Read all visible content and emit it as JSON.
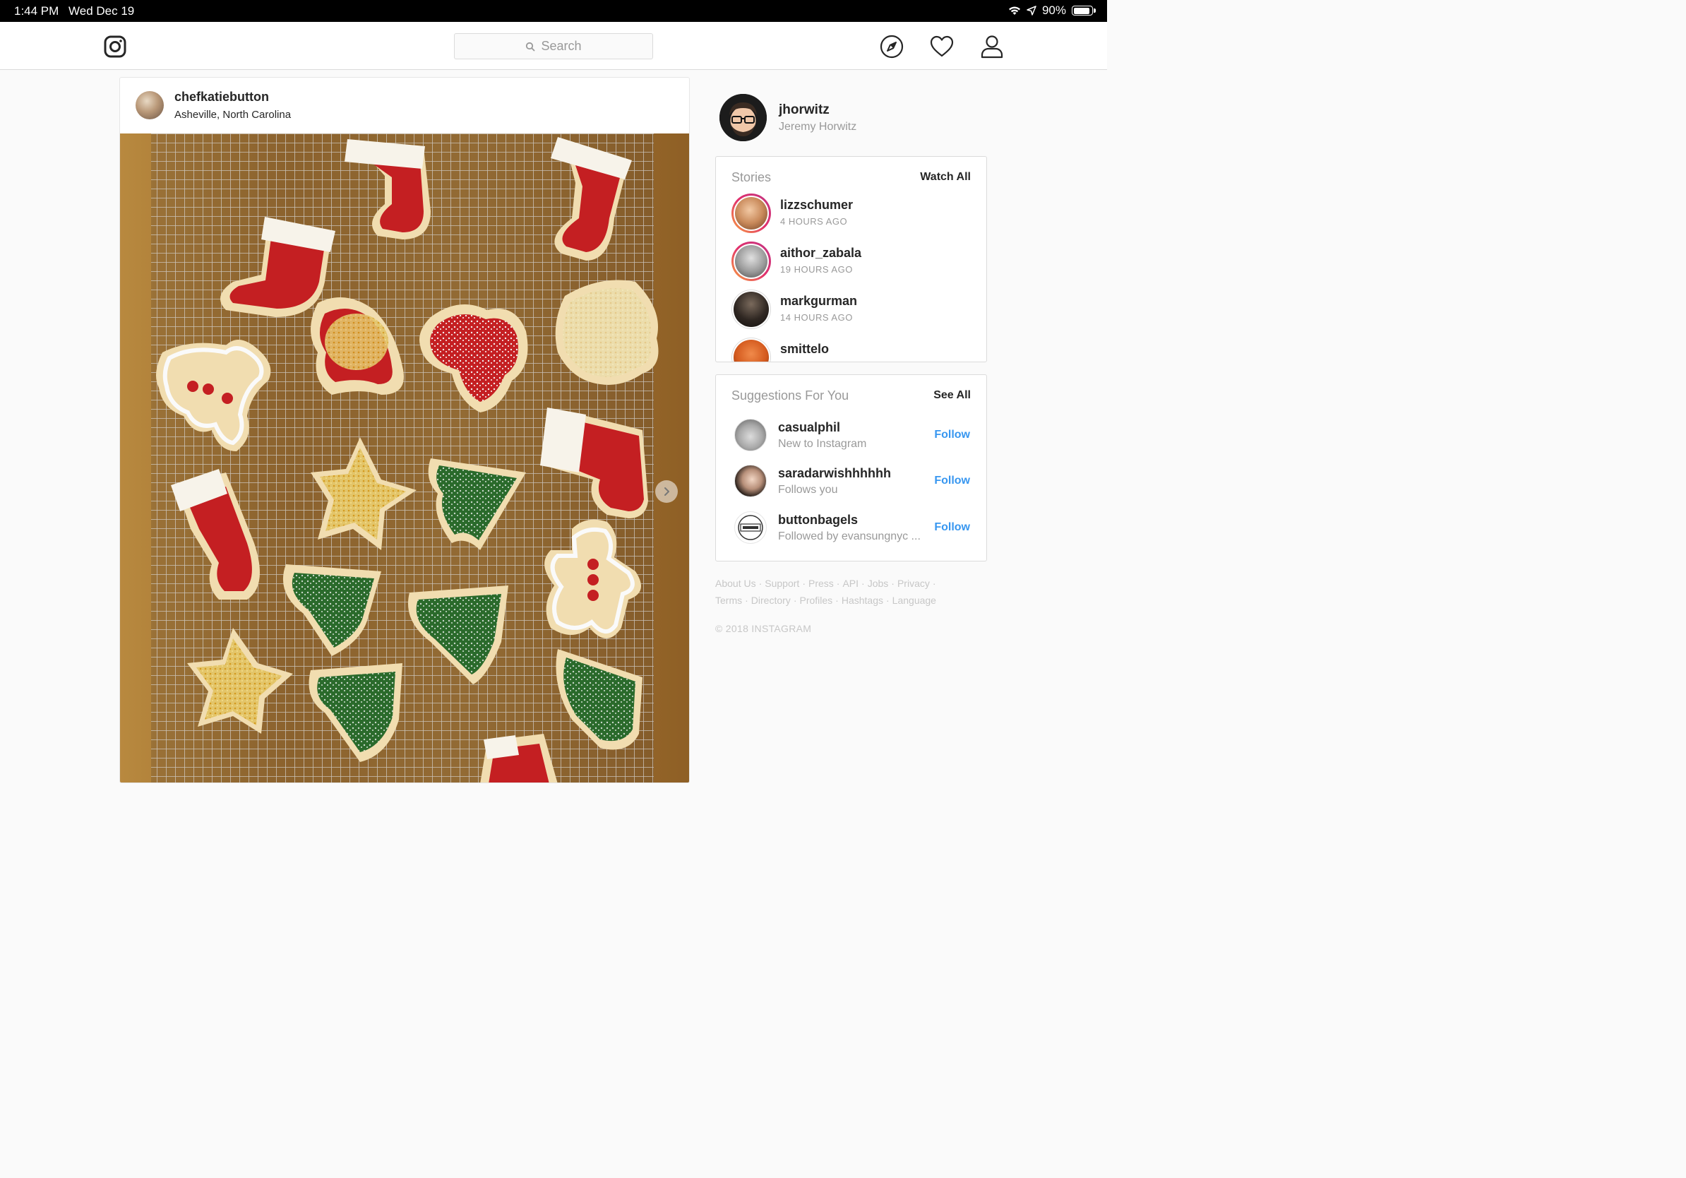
{
  "status_bar": {
    "time": "1:44 PM",
    "date": "Wed Dec 19",
    "battery": "90%",
    "battery_level": 0.9
  },
  "nav": {
    "search_placeholder": "Search",
    "icons": [
      "instagram-logo-icon",
      "search-icon",
      "compass-icon",
      "heart-icon",
      "profile-icon"
    ]
  },
  "post": {
    "username": "chefkatiebutton",
    "location": "Asheville, North Carolina",
    "next_icon": "chevron-right-icon"
  },
  "me": {
    "username": "jhorwitz",
    "full_name": "Jeremy Horwitz"
  },
  "stories": {
    "title": "Stories",
    "action": "Watch All",
    "items": [
      {
        "name": "lizzschumer",
        "time": "4 HOURS AGO"
      },
      {
        "name": "aithor_zabala",
        "time": "19 HOURS AGO"
      },
      {
        "name": "markgurman",
        "time": "14 HOURS AGO"
      },
      {
        "name": "smittelo",
        "time": ""
      }
    ]
  },
  "suggestions": {
    "title": "Suggestions For You",
    "action": "See All",
    "items": [
      {
        "name": "casualphil",
        "sub": "New to Instagram",
        "button": "Follow"
      },
      {
        "name": "saradarwishhhhhh",
        "sub": "Follows you",
        "button": "Follow"
      },
      {
        "name": "buttonbagels",
        "sub": "Followed by evansungnyc ...",
        "button": "Follow"
      }
    ]
  },
  "footer": {
    "links": [
      "About Us",
      "Support",
      "Press",
      "API",
      "Jobs",
      "Privacy",
      "Terms",
      "Directory",
      "Profiles",
      "Hashtags",
      "Language"
    ],
    "copyright": "© 2018 INSTAGRAM"
  },
  "colors": {
    "link_blue": "#3897f0",
    "muted": "#999999",
    "border": "#dbdbdb"
  }
}
